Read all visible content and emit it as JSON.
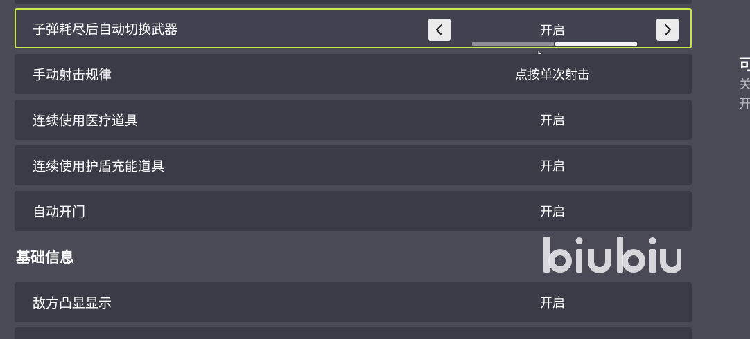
{
  "settings_rows": [
    {
      "label": "子弹耗尽后自动切换武器",
      "value": "开启"
    },
    {
      "label": "手动射击规律",
      "value": "点按单次射击"
    },
    {
      "label": "连续使用医疗道具",
      "value": "开启"
    },
    {
      "label": "连续使用护盾充能道具",
      "value": "开启"
    },
    {
      "label": "自动开门",
      "value": "开启"
    }
  ],
  "section": {
    "title": "基础信息"
  },
  "section_rows": [
    {
      "label": "敌方凸显显示",
      "value": "开启"
    }
  ],
  "selector": {
    "option_count": 2,
    "selected_index": 1,
    "icons": {
      "prev": "chevron-left-icon",
      "next": "chevron-right-icon"
    }
  },
  "watermark": {
    "text": "biubiu"
  },
  "side_panel": {
    "title": "可",
    "line1": "关",
    "line2": "开"
  },
  "colors": {
    "background": "#4a4a57",
    "row": "#3b3b47",
    "selected_border": "#c6e84a",
    "text": "#ffffff",
    "secondary_text": "#b8b8c2"
  }
}
